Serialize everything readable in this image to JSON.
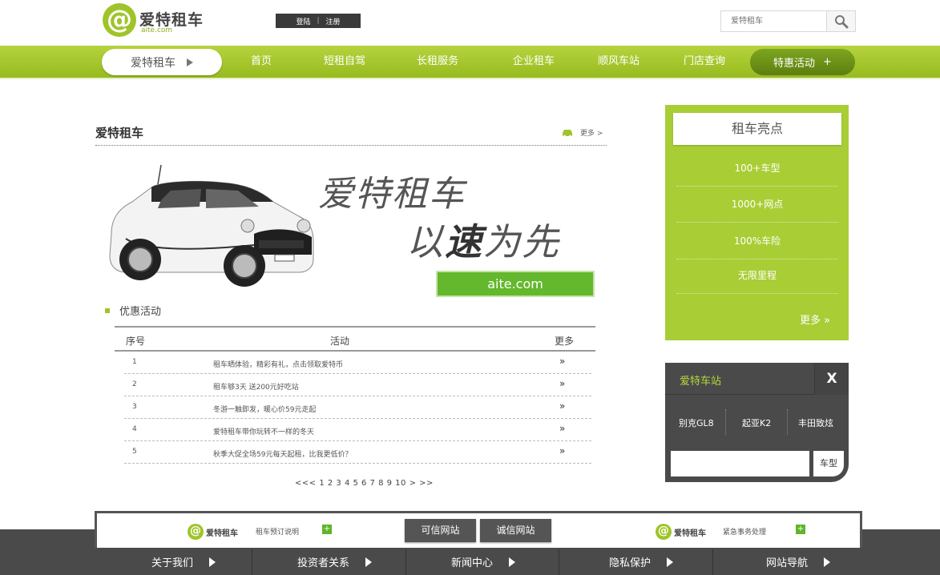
{
  "header": {
    "logo_name": "爱特租车",
    "logo_domain": "aite.com",
    "login": "登陆",
    "register": "注册",
    "search_placeholder": "爱特租车"
  },
  "nav": {
    "brand": "爱特租车",
    "items": [
      "首页",
      "短租自驾",
      "长租服务",
      "企业租车",
      "顺风车站",
      "门店查询"
    ],
    "special": "特惠活动",
    "special_plus": "+"
  },
  "main": {
    "section_title": "爱特租车",
    "more": "更多 >",
    "slogan_line1": "爱特租车",
    "slogan_line2_a": "以",
    "slogan_line2_b": "速",
    "slogan_line2_c": "为先",
    "domain_button": "aite.com",
    "promo_title": "优惠活动",
    "table": {
      "headers": [
        "序号",
        "活动",
        "更多"
      ],
      "rows": [
        {
          "no": "1",
          "text": "租车晒体验，精彩有礼，点击领取爱特币",
          "more": "»"
        },
        {
          "no": "2",
          "text": "租车够3天 送200元好吃站",
          "more": "»"
        },
        {
          "no": "3",
          "text": "冬游一触即发，暖心价59元走起",
          "more": "»"
        },
        {
          "no": "4",
          "text": "爱特租车带你玩转不一样的冬天",
          "more": "»"
        },
        {
          "no": "5",
          "text": "秋季大促全场59元每天起租，比我更低价？",
          "more": "»"
        }
      ]
    },
    "pager": "<<< 1 2 3 4 5 6 7 8 9 10 > >>"
  },
  "highlights": {
    "title": "租车亮点",
    "items": [
      "100+车型",
      "1000+网点",
      "100%车险",
      "无限里程"
    ],
    "more": "更多 »"
  },
  "stations": {
    "title": "爱特车站",
    "close": "X",
    "models": [
      "别克GL8",
      "起亚K2",
      "丰田致炫"
    ],
    "button": "车型"
  },
  "footer": {
    "logo_name": "爱特租车",
    "left_text": "租车预订说明",
    "right_text": "紧急事务处理",
    "plus": "+",
    "btn_trusted": "可信网站",
    "btn_honest": "诚信网站",
    "nav": [
      "关于我们",
      "投资者关系",
      "新闻中心",
      "隐私保护",
      "网站导航"
    ]
  },
  "colors": {
    "brand_green": "#9fc42a",
    "nav_green": "#a6c92e",
    "dark_panel": "#4a4a4a",
    "button_green": "#63b82d"
  },
  "icons": [
    "search-icon",
    "car-icon",
    "chevron-right-icon",
    "double-chevron-icon",
    "close-icon",
    "plus-icon"
  ]
}
